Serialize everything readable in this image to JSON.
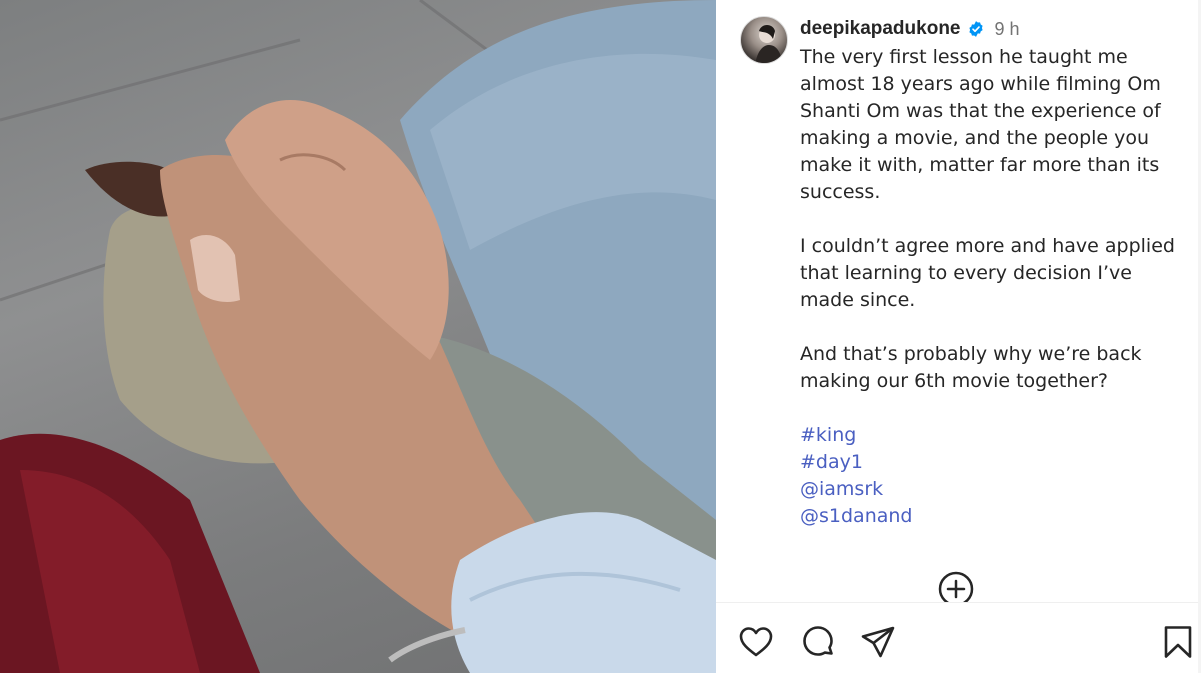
{
  "post": {
    "username": "deepikapadukone",
    "time_ago": "9 h",
    "caption": [
      "The very first lesson he taught me almost 18 years ago while filming Om Shanti Om was that the experience of making a movie, and the people you make it with, matter far more than its success.",
      "I couldn’t agree more and have applied that learning to every decision I’ve made since.",
      "And that’s probably why we’re back making our 6th movie together?"
    ],
    "tags": [
      "#king",
      "#day1",
      "@iamsrk",
      "@s1danand"
    ]
  },
  "icons": {
    "verified": "verified-badge-icon",
    "add": "plus-circle-icon",
    "like": "heart-icon",
    "comment": "comment-icon",
    "share": "share-icon",
    "save": "bookmark-icon"
  },
  "colors": {
    "link": "#4a5fc1",
    "verified": "#0095f6",
    "text": "#262626",
    "muted": "#737373"
  }
}
